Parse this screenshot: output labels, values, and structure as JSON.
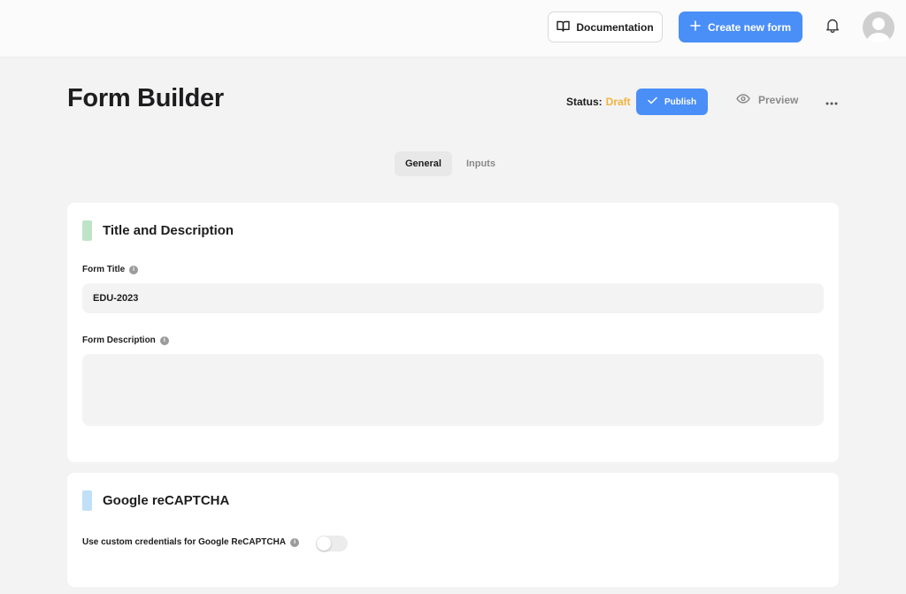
{
  "header": {
    "documentation_label": "Documentation",
    "create_label": "Create new form"
  },
  "page": {
    "title": "Form Builder",
    "status_label": "Status:",
    "status_value": "Draft",
    "publish_label": "Publish",
    "preview_label": "Preview"
  },
  "tabs": [
    {
      "label": "General",
      "active": true
    },
    {
      "label": "Inputs",
      "active": false
    }
  ],
  "section_title_desc": {
    "heading": "Title and Description",
    "form_title_label": "Form Title",
    "form_title_value": "EDU-2023",
    "form_description_label": "Form Description",
    "form_description_value": ""
  },
  "section_recaptcha": {
    "heading": "Google reCAPTCHA",
    "custom_credentials_label": "Use custom credentials for Google ReCAPTCHA",
    "custom_credentials_enabled": false
  },
  "colors": {
    "accent": "#4a8ef7",
    "draft_status": "#f2b33d",
    "marker_green": "#bfe3c8",
    "marker_blue": "#bfe0f7"
  },
  "icons": {
    "documentation": "book-icon",
    "create": "plus-icon",
    "notifications": "bell-icon",
    "publish": "check-icon",
    "preview": "eye-icon",
    "more": "more-horizontal-icon",
    "info": "info-icon"
  }
}
